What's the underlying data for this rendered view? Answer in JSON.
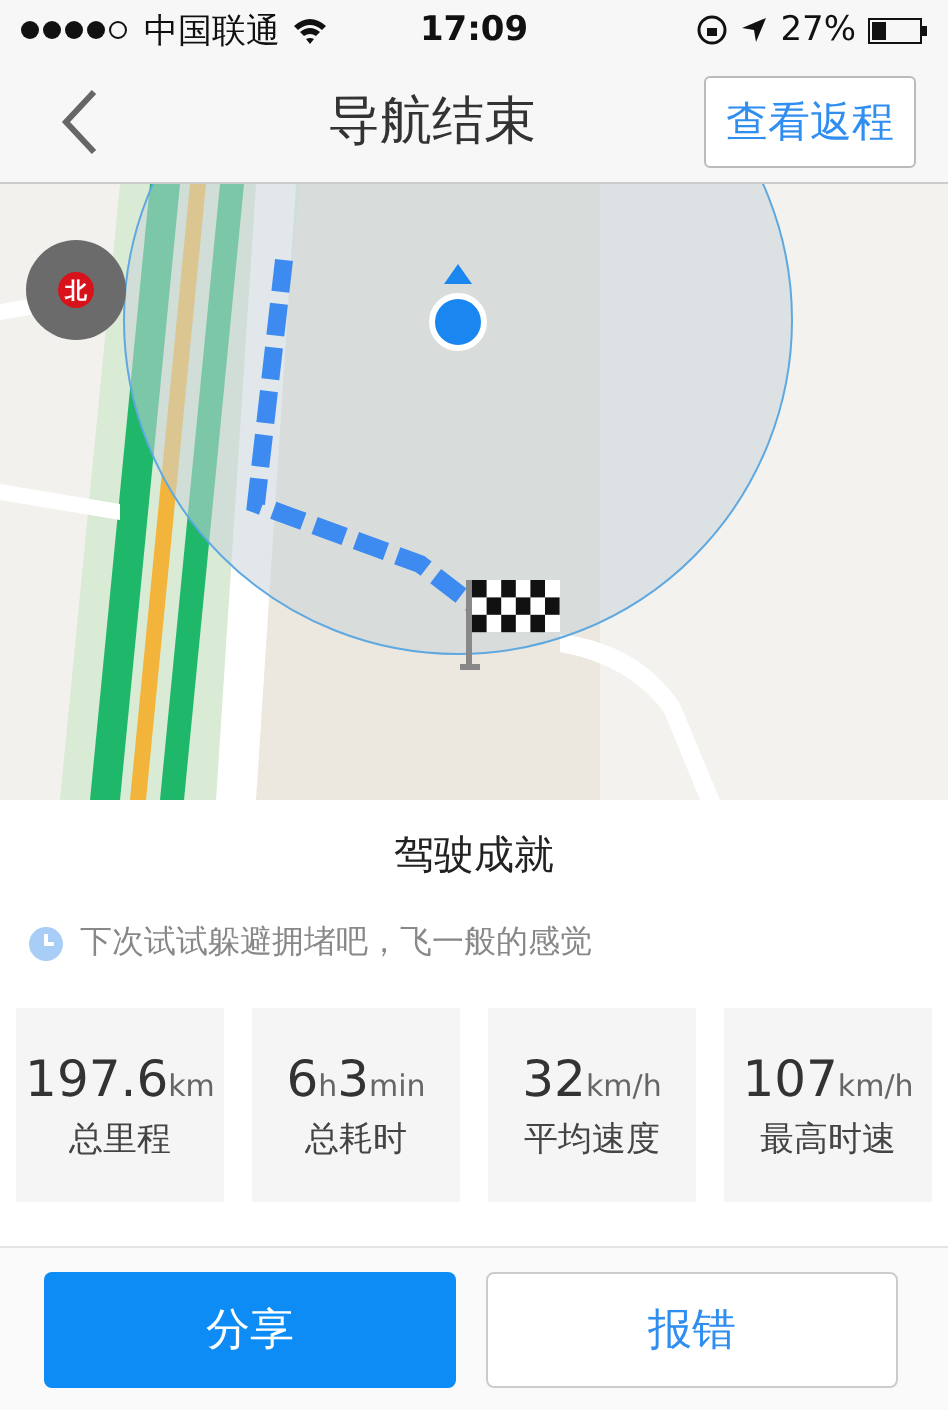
{
  "status_bar": {
    "carrier": "中国联通",
    "time": "17:09",
    "battery": "27%"
  },
  "nav_bar": {
    "title": "导航结束",
    "action": "查看返程"
  },
  "map": {
    "compass_label": "北"
  },
  "summary": {
    "title": "驾驶成就",
    "tip": "下次试试躲避拥堵吧，飞一般的感觉",
    "stats": [
      {
        "value": "197.6",
        "unit": "km",
        "label": "总里程"
      },
      {
        "value": "6",
        "unit": "h",
        "value2": "3",
        "unit2": "min",
        "label": "总耗时"
      },
      {
        "value": "32",
        "unit": "km/h",
        "label": "平均速度"
      },
      {
        "value": "107",
        "unit": "km/h",
        "label": "最高时速"
      }
    ]
  },
  "buttons": [
    {
      "label": "分享",
      "kind": "primary"
    },
    {
      "label": "报错",
      "kind": "secondary"
    }
  ]
}
